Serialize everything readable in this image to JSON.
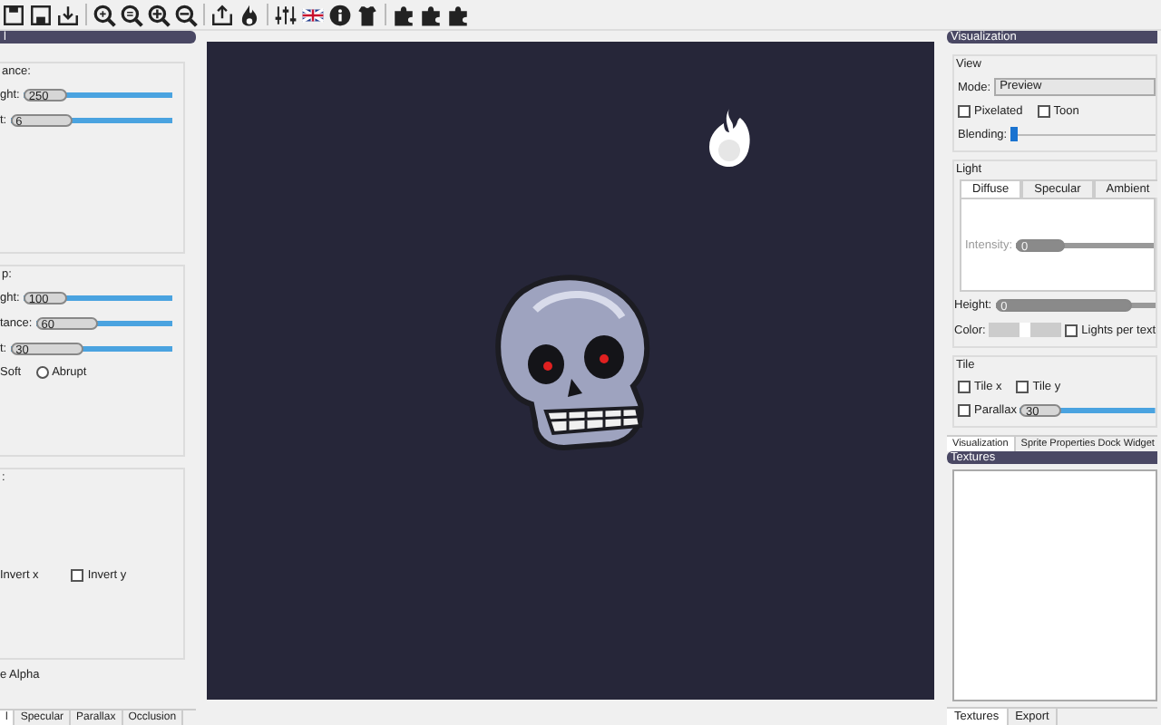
{
  "left_panel": {
    "title": "l",
    "groups": [
      {
        "label": "ance:",
        "sliders": [
          {
            "label": "ght:",
            "value": "250",
            "level": 0.3
          },
          {
            "label": "t:",
            "value": "6",
            "level": 0.38
          }
        ]
      },
      {
        "label": "p:",
        "sliders": [
          {
            "label": "ght:",
            "value": "100",
            "level": 0.3
          },
          {
            "label": "tance:",
            "value": "60",
            "level": 0.45
          },
          {
            "label": "t:",
            "value": "30",
            "level": 0.45
          }
        ],
        "options": [
          {
            "kind": "text",
            "label": "Soft"
          },
          {
            "kind": "radio",
            "label": "Abrupt",
            "selected": false
          }
        ]
      },
      {
        "label": ":",
        "checks": [
          {
            "kind": "text",
            "label": "Invert x"
          },
          {
            "kind": "checkbox",
            "label": "Invert y",
            "checked": false
          }
        ]
      }
    ],
    "footer": "e Alpha",
    "tabs": [
      {
        "label": "l",
        "selected": true
      },
      {
        "label": "Specular",
        "selected": false
      },
      {
        "label": "Parallax",
        "selected": false
      },
      {
        "label": "Occlusion",
        "selected": false
      }
    ]
  },
  "right_panel": {
    "title": "Visualization",
    "view": {
      "label": "View",
      "mode_label": "Mode:",
      "mode": "Preview",
      "checks": [
        {
          "label": "Pixelated",
          "checked": false
        },
        {
          "label": "Toon",
          "checked": false
        }
      ],
      "blending_label": "Blending:",
      "blending": {
        "level": 0
      }
    },
    "light": {
      "label": "Light",
      "tabs": [
        {
          "label": "Diffuse",
          "selected": true
        },
        {
          "label": "Specular",
          "selected": false
        },
        {
          "label": "Ambient",
          "selected": false
        }
      ],
      "intensity_label": "Intensity:",
      "intensity": {
        "value": "0",
        "level": 0.35,
        "disabled": true
      },
      "height_label": "Height:",
      "height": {
        "value": "0",
        "level": 0.85,
        "disabled": true
      },
      "color_label": "Color:",
      "color": "#ffffff",
      "lights_check": {
        "label": "Lights per text",
        "checked": false
      }
    },
    "tile": {
      "label": "Tile",
      "checks": [
        {
          "label": "Tile x",
          "checked": false
        },
        {
          "label": "Tile y",
          "checked": false
        }
      ],
      "parallax": {
        "label": "Parallax",
        "checked": false,
        "value": "30",
        "level": 0.3
      }
    },
    "tabs": [
      {
        "label": "Visualization",
        "selected": true
      },
      {
        "label": "Sprite Properties Dock Widget",
        "selected": false
      }
    ],
    "textures_title": "Textures",
    "bottom_tabs": [
      {
        "label": "Textures",
        "selected": true
      },
      {
        "label": "Export",
        "selected": false
      }
    ]
  }
}
